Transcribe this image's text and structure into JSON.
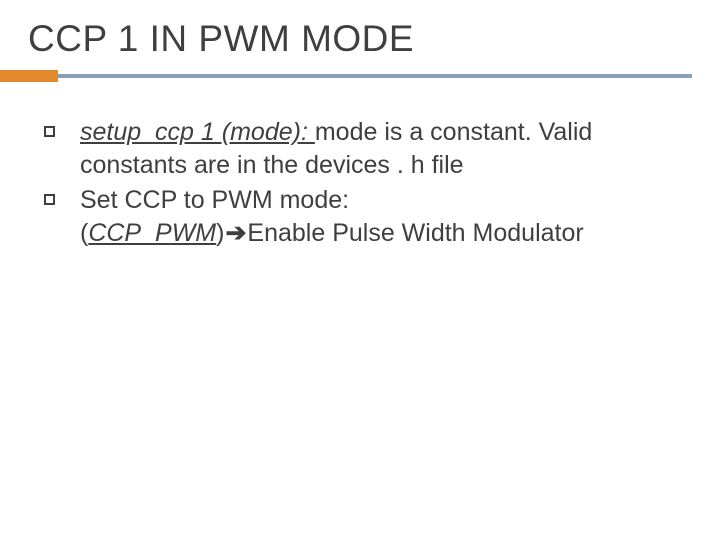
{
  "title": "CCP 1 IN PWM MODE",
  "bullets": [
    {
      "lead_code": "setup_ccp 1 (mode): ",
      "lead_plain": "mode",
      "rest": " is a constant. Valid constants are in the devices . h file"
    },
    {
      "line1": "Set CCP to PWM mode:",
      "paren_open": "(",
      "code": "CCP_PWM",
      "paren_close": ")",
      "arrow": "➔",
      "after": "Enable Pulse Width Modulator"
    }
  ]
}
